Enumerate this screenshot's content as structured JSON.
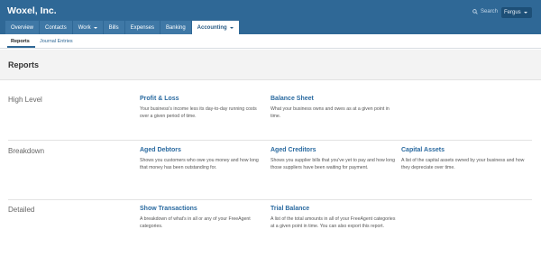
{
  "app": {
    "company": "Woxel, Inc."
  },
  "search": {
    "label": "Search"
  },
  "user": {
    "name": "Fergus"
  },
  "nav": [
    {
      "label": "Overview",
      "has_menu": false,
      "active": false
    },
    {
      "label": "Contacts",
      "has_menu": false,
      "active": false
    },
    {
      "label": "Work",
      "has_menu": true,
      "active": false
    },
    {
      "label": "Bills",
      "has_menu": false,
      "active": false
    },
    {
      "label": "Expenses",
      "has_menu": false,
      "active": false
    },
    {
      "label": "Banking",
      "has_menu": false,
      "active": false
    },
    {
      "label": "Accounting",
      "has_menu": true,
      "active": true
    }
  ],
  "subnav": [
    {
      "label": "Reports",
      "active": true
    },
    {
      "label": "Journal Entries",
      "active": false
    }
  ],
  "page": {
    "title": "Reports"
  },
  "sections": {
    "high_level": {
      "label": "High Level",
      "reports": [
        {
          "title": "Profit & Loss",
          "desc": "Your business's income less its day-to-day running costs over a given period of time."
        },
        {
          "title": "Balance Sheet",
          "desc": "What your business owns and owes as at a given point in time."
        }
      ]
    },
    "breakdown": {
      "label": "Breakdown",
      "reports": [
        {
          "title": "Aged Debtors",
          "desc": "Shows you customers who owe you money and how long that money has been outstanding for."
        },
        {
          "title": "Aged Creditors",
          "desc": "Shows you supplier bills that you've yet to pay and how long those suppliers have been waiting for payment."
        },
        {
          "title": "Capital Assets",
          "desc": "A list of the capital assets owned by your business and how they depreciate over time."
        }
      ]
    },
    "detailed": {
      "label": "Detailed",
      "reports": [
        {
          "title": "Show Transactions",
          "desc": "A breakdown of what's in all or any of your FreeAgent categories."
        },
        {
          "title": "Trial Balance",
          "desc": "A list of the total amounts in all of your FreeAgent categories at a given point in time. You can also export this report."
        }
      ]
    }
  }
}
